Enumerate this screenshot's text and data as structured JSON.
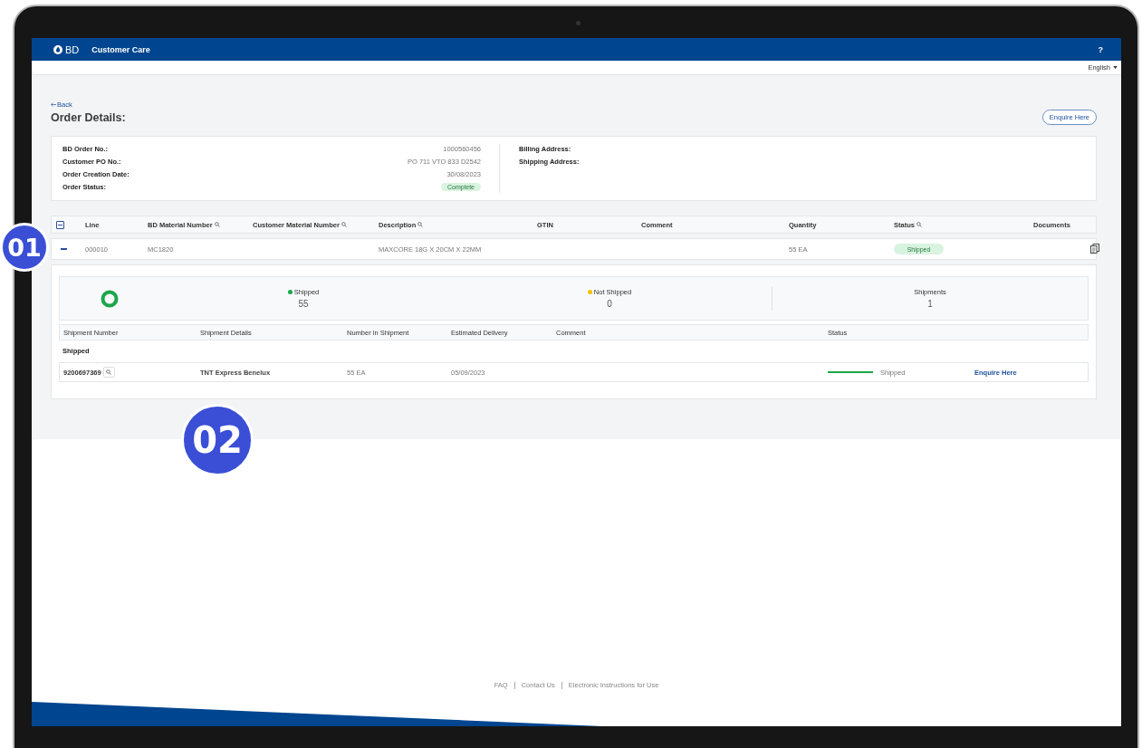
{
  "header": {
    "logo": "BD",
    "title": "Customer Care",
    "help": "?"
  },
  "language": "English",
  "back": "Back",
  "page_title": "Order Details:",
  "enquire_button": "Enquire Here",
  "order_info": {
    "fields": [
      {
        "label": "BD Order No.:",
        "value": "1000560456",
        "kind": "text"
      },
      {
        "label": "Customer PO No.:",
        "value": "PO 711 VTO 833 D2542",
        "kind": "text"
      },
      {
        "label": "Order Creation Date:",
        "value": "30/08/2023",
        "kind": "text"
      },
      {
        "label": "Order Status:",
        "value": "Complete",
        "kind": "badge"
      }
    ],
    "address_fields": [
      "Billing Address:",
      "Shipping Address:"
    ]
  },
  "lines_table": {
    "columns": [
      {
        "label": "Line",
        "searchable": false
      },
      {
        "label": "BD Material Number",
        "searchable": true
      },
      {
        "label": "Customer Material Number",
        "searchable": true
      },
      {
        "label": "Description",
        "searchable": true
      },
      {
        "label": "GTIN",
        "searchable": false
      },
      {
        "label": "Comment",
        "searchable": false
      },
      {
        "label": "Quantity",
        "searchable": false
      },
      {
        "label": "Status",
        "searchable": true
      },
      {
        "label": "Documents",
        "searchable": false
      }
    ],
    "rows": [
      {
        "line": "000010",
        "bd_material": "MC1820",
        "description": "MAXCORE 18G X 20CM X 22MM",
        "quantity": "55 EA",
        "status": "Shipped",
        "expanded": true
      }
    ]
  },
  "shipments_panel": {
    "summary": [
      {
        "label": "Shipped",
        "value": "55",
        "color": "#1aa64a"
      },
      {
        "label": "Not Shipped",
        "value": "0",
        "color": "#f2c200"
      },
      {
        "label": "Shipments",
        "value": "1"
      }
    ],
    "columns": [
      "Shipment Number",
      "Shipment Details",
      "Number in Shipment",
      "Estimated Delivery",
      "Comment",
      "Status"
    ],
    "group_label": "Shipped",
    "shipments": [
      {
        "number": "9200697369",
        "details": "TNT Express Benelux",
        "quantity": "55 EA",
        "delivery": "05/09/2023",
        "level": 1,
        "status": "Shipped",
        "link": "Enquire Here"
      }
    ]
  },
  "footer_links": [
    "FAQ",
    "Contact Us",
    "Electronic Instructions for Use"
  ],
  "callouts": [
    "01",
    "02"
  ]
}
